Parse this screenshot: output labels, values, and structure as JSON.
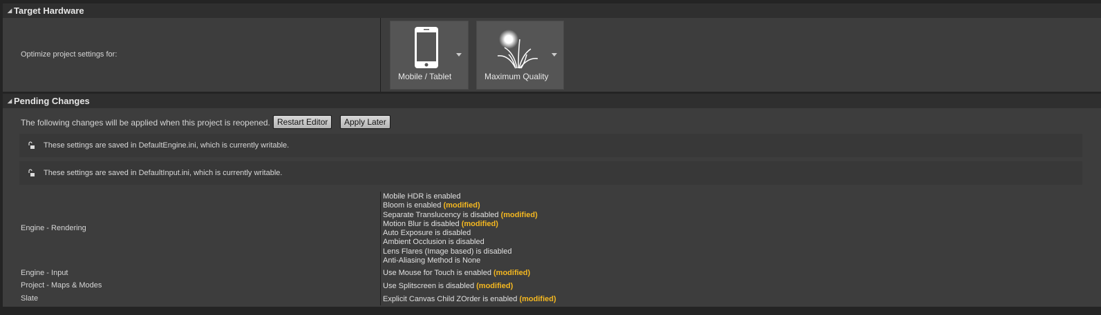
{
  "target_hardware": {
    "title": "Target Hardware",
    "label": "Optimize project settings for:",
    "platform": {
      "label": "Mobile / Tablet",
      "icon": "phone-icon"
    },
    "quality": {
      "label": "Maximum Quality",
      "icon": "sun-grass-icon"
    }
  },
  "pending": {
    "title": "Pending Changes",
    "message": "The following changes will be applied when this project is reopened.",
    "restart_label": "Restart Editor",
    "apply_later_label": "Apply Later",
    "info": [
      "These settings are saved in DefaultEngine.ini, which is currently writable.",
      "These settings are saved in DefaultInput.ini, which is currently writable."
    ],
    "modified_tag": "(modified)",
    "groups": [
      {
        "category": "Engine - Rendering",
        "changes": [
          {
            "text": "Mobile HDR is enabled",
            "modified": false
          },
          {
            "text": "Bloom is enabled",
            "modified": true
          },
          {
            "text": "Separate Translucency is disabled",
            "modified": true
          },
          {
            "text": "Motion Blur is disabled",
            "modified": true
          },
          {
            "text": "Auto Exposure is disabled",
            "modified": false
          },
          {
            "text": "Ambient Occlusion is disabled",
            "modified": false
          },
          {
            "text": "Lens Flares (Image based) is disabled",
            "modified": false
          },
          {
            "text": "Anti-Aliasing Method is None",
            "modified": false
          }
        ]
      },
      {
        "category": "Engine - Input",
        "changes": [
          {
            "text": "Use Mouse for Touch is enabled",
            "modified": true
          }
        ]
      },
      {
        "category": "Project - Maps & Modes",
        "changes": [
          {
            "text": "Use Splitscreen is disabled",
            "modified": true
          }
        ]
      },
      {
        "category": "Slate",
        "changes": [
          {
            "text": "Explicit Canvas Child ZOrder is enabled",
            "modified": true
          }
        ]
      }
    ]
  },
  "colors": {
    "modified": "#f5b820",
    "panel": "#3d3d3d",
    "header": "#2f2f2f"
  }
}
